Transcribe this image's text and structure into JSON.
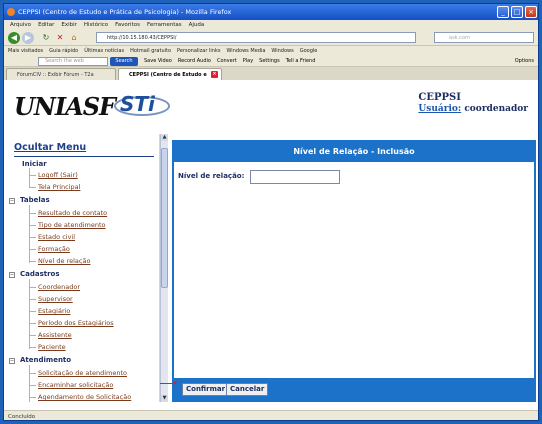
{
  "window": {
    "title": "CEPPSI (Centro de Estudo e Prática de Psicologia) - Mozilla Firefox",
    "controls": [
      "_",
      "□",
      "×"
    ]
  },
  "menubar": [
    "Arquivo",
    "Editar",
    "Exibir",
    "Histórico",
    "Favoritos",
    "Ferramentas",
    "Ajuda"
  ],
  "navbar": {
    "url": "http://10.15.180.43/CEPPSI/",
    "search_placeholder": "ask.com"
  },
  "bookmarks": [
    "Mais visitados",
    "Guia rápido",
    "Últimas notícias",
    "Hotmail gratuito",
    "Personalizar links",
    "Windows Media",
    "Windows",
    "Google"
  ],
  "toolbar2": {
    "search_placeholder": "Search the web",
    "search_label": "Search",
    "items": [
      "Save Video",
      "Record Audio",
      "Convert",
      "Play",
      "Settings",
      "Tell a Friend"
    ],
    "options_label": "Options"
  },
  "tabs": [
    {
      "label": "FórumCIV :: Exibir Fórum - T2a"
    },
    {
      "label": "CEPPSI (Centro de Estudo e Práti..."
    }
  ],
  "header": {
    "logo_left": "UNIASF",
    "logo_right": "STi",
    "system": "CEPPSI",
    "user_label": "Usuário:",
    "user_name": "coordenador"
  },
  "sidebar": {
    "hide_menu": "Ocultar Menu",
    "sections": [
      {
        "title": "Iniciar",
        "items": [
          "Logoff (Sair)",
          "Tela Principal"
        ]
      },
      {
        "title": "Tabelas",
        "items": [
          "Resultado de contato",
          "Tipo de atendimento",
          "Estado civil",
          "Formação",
          "Nível de relação"
        ]
      },
      {
        "title": "Cadastros",
        "items": [
          "Coordenador",
          "Supervisor",
          "Estagiário",
          "Período dos Estagiários",
          "Assistente",
          "Paciente"
        ]
      },
      {
        "title": "Atendimento",
        "items": [
          "Solicitação de atendimento",
          "Encaminhar solicitação",
          "Agendamento de Solicitação"
        ]
      }
    ]
  },
  "main": {
    "heading": "Nível de Relação - Inclusão",
    "field_label": "Nível de relação:",
    "field_value": "",
    "confirm_label": "Confirmar",
    "cancel_label": "Cancelar"
  },
  "status": "Concluído"
}
